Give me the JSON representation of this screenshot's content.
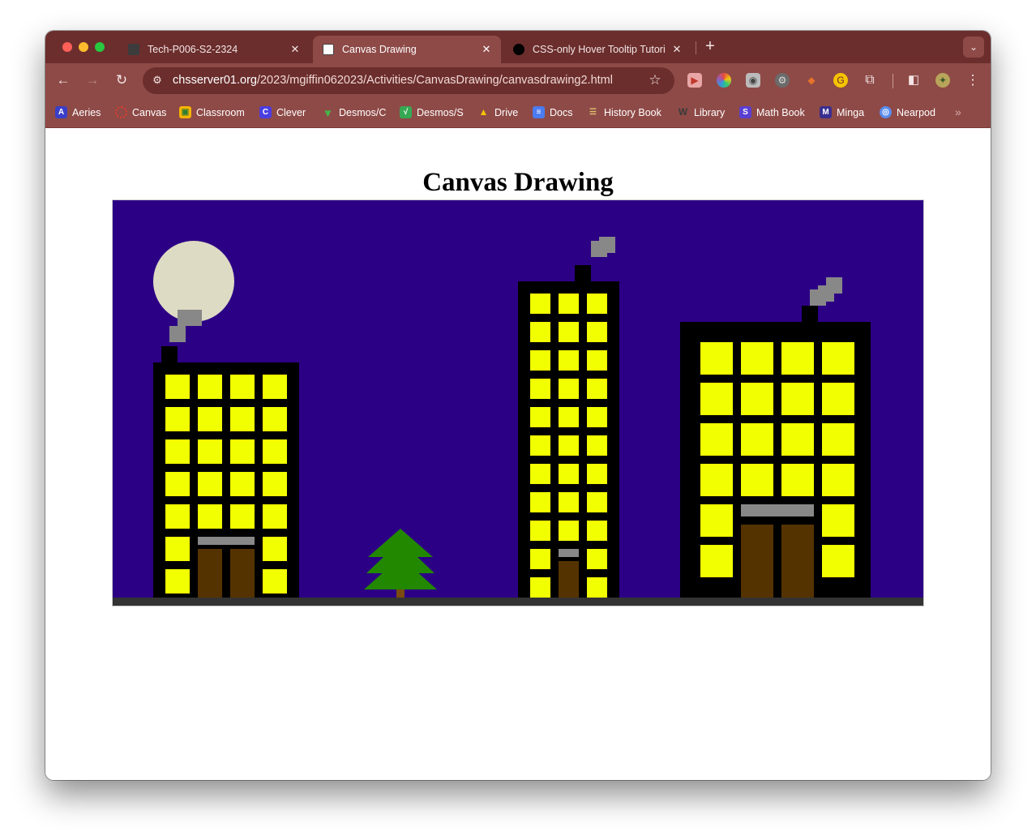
{
  "browser": {
    "tabs": [
      {
        "title": "Tech-P006-S2-2324",
        "active": false,
        "favicon": "classroom-icon",
        "color": "#3c3c3c"
      },
      {
        "title": "Canvas Drawing",
        "active": true,
        "favicon": "page-icon",
        "color": "#ffffff"
      },
      {
        "title": "CSS-only Hover Tooltip Tutori",
        "active": false,
        "favicon": "medium-icon",
        "color": "#000000"
      }
    ],
    "url_host": "chsserver01.org",
    "url_path": "/2023/mgiffin062023/Activities/CanvasDrawing/canvasdrawing2.html",
    "bookmarks": [
      {
        "label": "Aeries",
        "icon": "aeries-icon",
        "color": "#3b3fc8",
        "glyph": "A"
      },
      {
        "label": "Canvas",
        "icon": "canvas-icon",
        "color": "#e13d2c",
        "glyph": "◌"
      },
      {
        "label": "Classroom",
        "icon": "classroom-icon",
        "color": "#f5b400",
        "glyph": "▣"
      },
      {
        "label": "Clever",
        "icon": "clever-icon",
        "color": "#4b3ee0",
        "glyph": "C"
      },
      {
        "label": "Desmos/C",
        "icon": "desmos-c-icon",
        "color": "#2f8a3c",
        "glyph": "⩔"
      },
      {
        "label": "Desmos/S",
        "icon": "desmos-s-icon",
        "color": "#35a853",
        "glyph": "√"
      },
      {
        "label": "Drive",
        "icon": "drive-icon",
        "color": "#1fa463",
        "glyph": "▲"
      },
      {
        "label": "Docs",
        "icon": "docs-icon",
        "color": "#4b7bf0",
        "glyph": "≡"
      },
      {
        "label": "History Book",
        "icon": "history-book-icon",
        "color": "#6a5a2a",
        "glyph": "☰"
      },
      {
        "label": "Library",
        "icon": "library-icon",
        "color": "#3a3a3a",
        "glyph": "W"
      },
      {
        "label": "Math Book",
        "icon": "math-book-icon",
        "color": "#5a3fd1",
        "glyph": "S"
      },
      {
        "label": "Minga",
        "icon": "minga-icon",
        "color": "#3a2f8f",
        "glyph": "M"
      },
      {
        "label": "Nearpod",
        "icon": "nearpod-icon",
        "color": "#5a8cf0",
        "glyph": "◎"
      }
    ]
  },
  "page": {
    "title": "Canvas Drawing"
  },
  "scene": {
    "colors": {
      "sky": "#2c0085",
      "moon": "#dddbc3",
      "building": "#000000",
      "window": "#f2ff00",
      "door": "#553300",
      "awning": "#888888",
      "smoke": "#888888",
      "ground": "#333333",
      "tree": "#228800",
      "trunk": "#7a4a10"
    }
  }
}
